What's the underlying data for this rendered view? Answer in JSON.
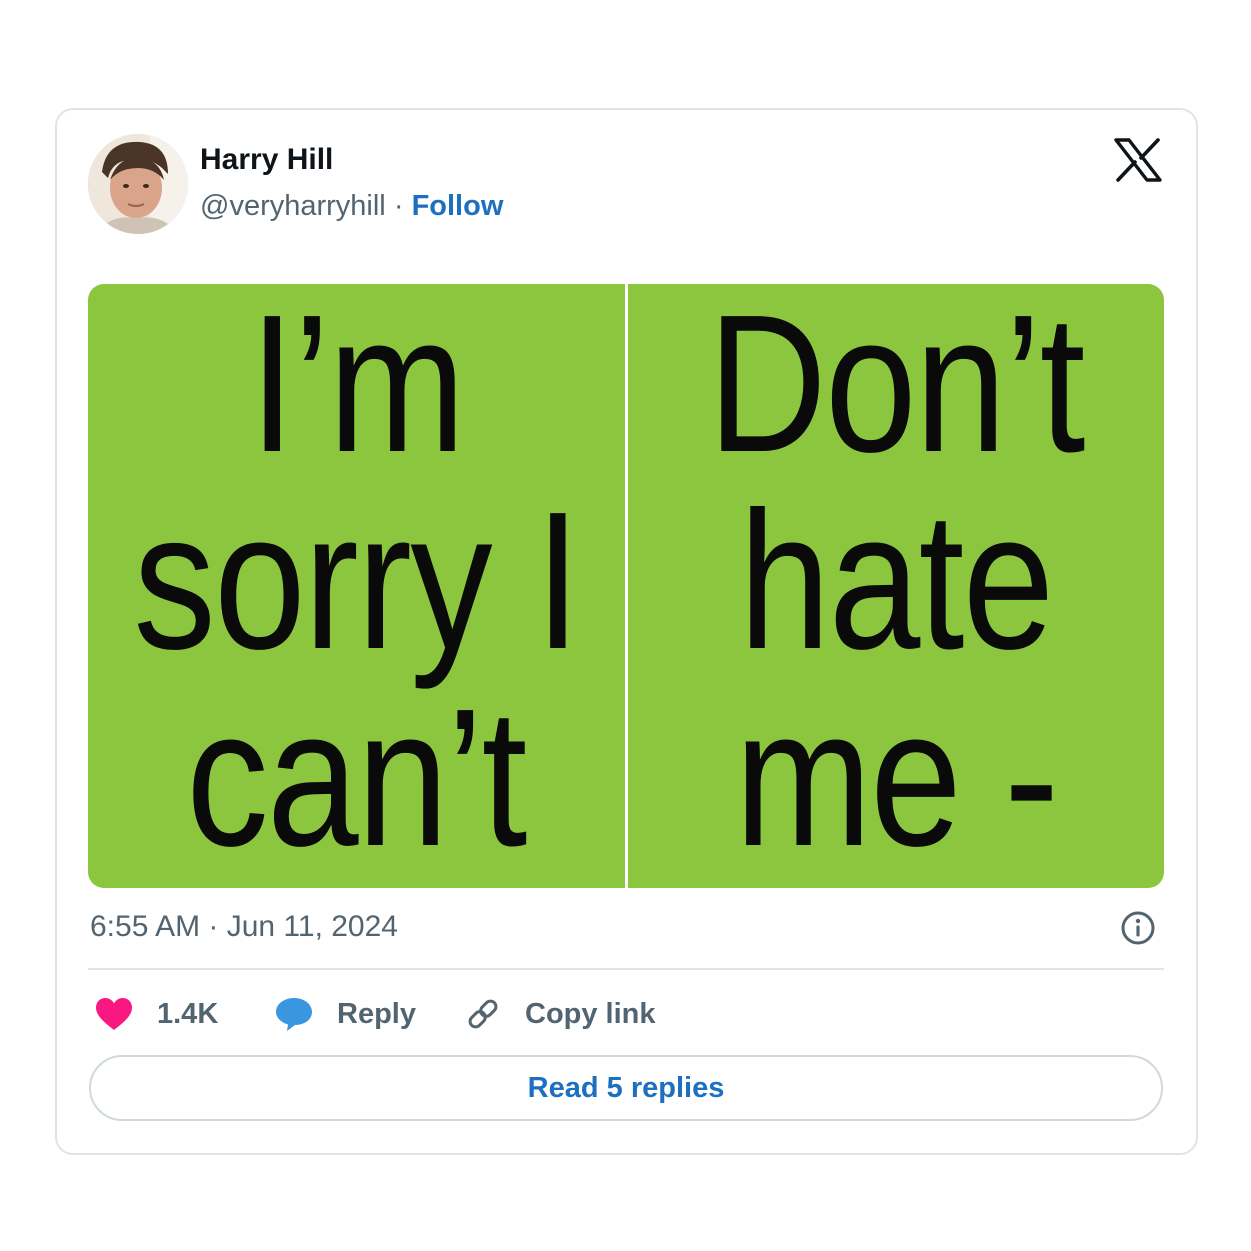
{
  "tweet": {
    "author_name": "Harry Hill",
    "author_handle": "@veryharryhill",
    "separator": "·",
    "follow_label": "Follow",
    "timestamp": "6:55 AM · Jun 11, 2024"
  },
  "media": {
    "left_lines": [
      "I’m",
      "sorry I",
      "can’t"
    ],
    "right_lines": [
      "Don’t",
      "hate",
      "me -"
    ],
    "background_color": "#8cc63f"
  },
  "actions": {
    "like_count": "1.4K",
    "reply_label": "Reply",
    "copy_link_label": "Copy link",
    "read_replies_label": "Read 5 replies"
  },
  "icons": {
    "logo": "x-logo-icon",
    "info": "info-icon",
    "like": "heart-icon",
    "reply": "speech-bubble-icon",
    "copy": "link-icon"
  },
  "colors": {
    "accent_blue": "#1d6fbf",
    "heart_pink": "#f91880",
    "reply_blue": "#3b96e0",
    "text_secondary": "#536471"
  }
}
